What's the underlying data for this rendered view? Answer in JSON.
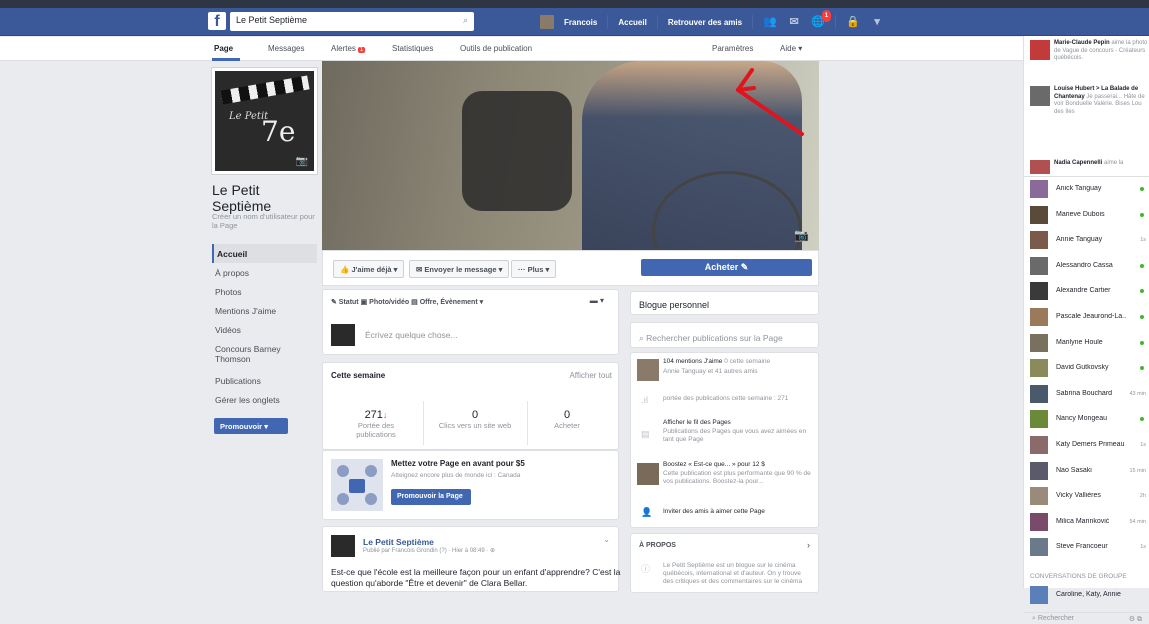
{
  "topbar": {
    "search_value": "Le Petit Septième",
    "user_name": "Francois",
    "home_label": "Accueil",
    "find_friends_label": "Retrouver des amis",
    "notif_count": "1"
  },
  "page_nav": {
    "tabs": [
      "Page",
      "Messages",
      "Alertes",
      "Statistiques",
      "Outils de publication"
    ],
    "alerts_badge": "1",
    "settings_label": "Paramètres",
    "help_label": "Aide ▾"
  },
  "profile": {
    "clap_text": "Le Petit",
    "clap_number": "7e",
    "page_name": "Le Petit Septième",
    "username_prompt": "Créer un nom d'utilisateur pour la Page"
  },
  "side_nav": {
    "items": [
      "Accueil",
      "À propos",
      "Photos",
      "Mentions J'aime",
      "Vidéos",
      "Concours Barney Thomson",
      "Publications",
      "Gérer les onglets"
    ],
    "promote_label": "Promouvoir"
  },
  "actions": {
    "like_label": "J'aime déjà ▾",
    "message_label": "Envoyer le message ▾",
    "more_label": "··· Plus ▾",
    "buy_label": "Acheter ✎"
  },
  "composer": {
    "tabs": "✎ Statut   ▣ Photo/vidéo   ▤ Offre, Évènement ▾",
    "placeholder": "Écrivez quelque chose..."
  },
  "week": {
    "title": "Cette semaine",
    "see_all": "Afficher tout",
    "stats": [
      {
        "value": "271",
        "label": "Portée des publications"
      },
      {
        "value": "0",
        "label": "Clics vers un site web"
      },
      {
        "value": "0",
        "label": "Acheter"
      }
    ]
  },
  "promo": {
    "title": "Mettez votre Page en avant pour $5",
    "subtitle": "Atteignez encore plus de monde ici : Canada",
    "cta": "Promouvoir la Page"
  },
  "post": {
    "author": "Le Petit Septième",
    "meta": "Publié par Francois Grondin (?) · Hier à 08:49 · ⊕",
    "text": "Est-ce que l'école est la meilleure façon pour un enfant d'apprendre? C'est la question qu'aborde \"Être et devenir\" de Clara Bellar."
  },
  "right_cards": {
    "blog_title": "Blogue personnel",
    "search_placeholder": "Rechercher publications sur la Page",
    "likes_line": "104 mentions J'aime",
    "likes_extra": "0 cette semaine",
    "likes_friends": "Annie Tanguay et 41 autres amis",
    "reach_line": "portée des publications cette semaine : 271",
    "pages_title": "Afficher le fil des Pages",
    "pages_sub": "Publications des Pages que vous avez aimées en tant que Page",
    "boost_title": "Boostez « Est-ce que... » pour 12 $",
    "boost_sub": "Cette publication est plus performante que 90 % de vos publications. Boostez-la pour...",
    "invite_line": "Inviter des amis à aimer cette Page",
    "about_title": "À PROPOS",
    "about_text": "Le Petit Septième est un blogue sur le cinéma québécois, international et d'auteur. On y trouve des critiques et des commentaires sur le cinéma"
  },
  "ticker": [
    {
      "name": "Marie-Claude Pepin",
      "text": " aime la photo de Vague de concours - Créateurs québécois."
    },
    {
      "name": "Louise Hubert > La Balade de Chantenay",
      "text": " Je passerai... Hâte de voir Bonduelle Valérie. Bises Lou des îles"
    },
    {
      "name": "Nadia Capennelli",
      "text": " aime la"
    }
  ],
  "chat": [
    {
      "name": "Anick Tanguay",
      "status": "online",
      "time": ""
    },
    {
      "name": "Marieve Dubois",
      "status": "online",
      "time": ""
    },
    {
      "name": "Annie Tanguay",
      "status": "time",
      "time": "1s"
    },
    {
      "name": "Alessandro Cassa",
      "status": "online",
      "time": ""
    },
    {
      "name": "Alexandre Cartier",
      "status": "online",
      "time": ""
    },
    {
      "name": "Pascale Jeaurond-La...",
      "status": "online",
      "time": ""
    },
    {
      "name": "Marilyne Houle",
      "status": "online",
      "time": ""
    },
    {
      "name": "David Gutkovsky",
      "status": "online",
      "time": ""
    },
    {
      "name": "Sabrina Bouchard",
      "status": "time",
      "time": "43 min"
    },
    {
      "name": "Nancy Mongeau",
      "status": "online",
      "time": ""
    },
    {
      "name": "Katy Demers Primeau",
      "status": "time",
      "time": "1s"
    },
    {
      "name": "Nao Sasaki",
      "status": "time",
      "time": "15 min"
    },
    {
      "name": "Vicky Vallières",
      "status": "time",
      "time": "2h"
    },
    {
      "name": "Milica Marinković",
      "status": "time",
      "time": "54 min"
    },
    {
      "name": "Steve Francoeur",
      "status": "time",
      "time": "1s"
    }
  ],
  "chat_footer": {
    "group_title": "Conversations de groupe",
    "group_row": "Caroline, Katy, Annie",
    "search_placeholder": "Rechercher"
  },
  "colors": {
    "brand": "#3b5998",
    "accent": "#4267b2",
    "online": "#42b72a",
    "alert": "#fa3e3e",
    "annotation": "#e0141e"
  }
}
